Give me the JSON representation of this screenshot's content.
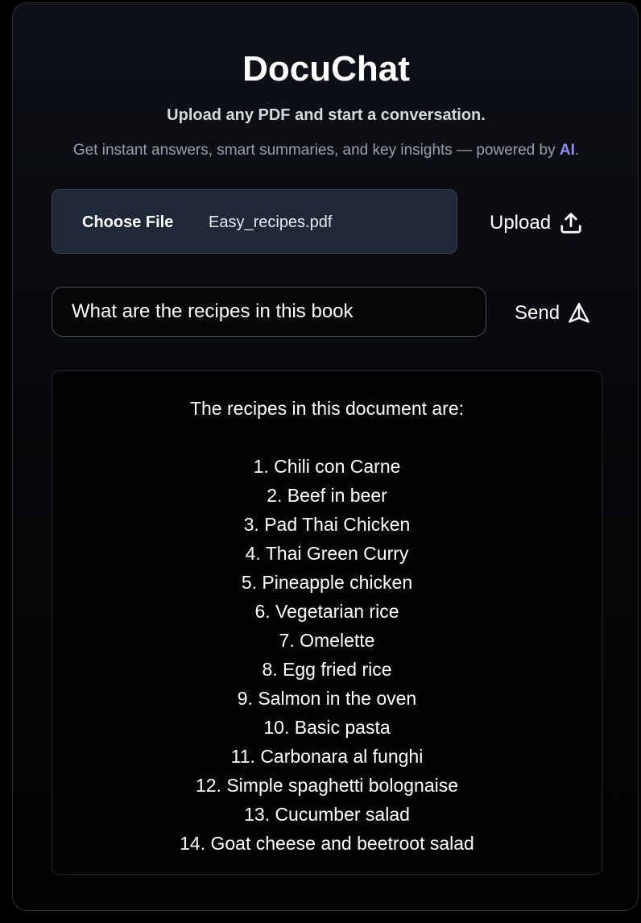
{
  "header": {
    "title": "DocuChat",
    "subtitle": "Upload any PDF and start a conversation.",
    "tagline_prefix": "Get instant answers, smart summaries, and key insights — powered by ",
    "tagline_highlight": "AI",
    "tagline_suffix": "."
  },
  "upload": {
    "choose_file_label": "Choose File",
    "file_name": "Easy_recipes.pdf",
    "upload_label": "Upload",
    "upload_icon": "upload-icon"
  },
  "query": {
    "input_value": "What are the recipes in this book",
    "send_label": "Send",
    "send_icon": "send-icon"
  },
  "answer": {
    "intro": "The recipes in this document are:",
    "items": [
      "1. Chili con Carne",
      "2. Beef in beer",
      "3. Pad Thai Chicken",
      "4. Thai Green Curry",
      "5. Pineapple chicken",
      "6. Vegetarian rice",
      "7. Omelette",
      "8. Egg fried rice",
      "9. Salmon in the oven",
      "10. Basic pasta",
      "11. Carbonara al funghi",
      "12. Simple spaghetti bolognaise",
      "13. Cucumber salad",
      "14. Goat cheese and beetroot salad"
    ]
  },
  "colors": {
    "accent_ai": "#8f8cf5",
    "file_box_bg": "#1f2937",
    "page_bg": "#000000"
  }
}
